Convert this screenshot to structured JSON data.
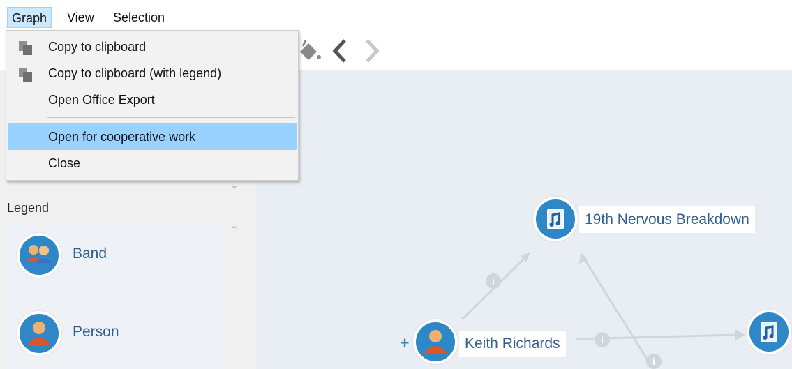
{
  "menubar": {
    "items": [
      {
        "label": "Graph"
      },
      {
        "label": "View"
      },
      {
        "label": "Selection"
      }
    ]
  },
  "dropdown": {
    "items": [
      {
        "label": "Copy to clipboard",
        "icon": "copy-icon"
      },
      {
        "label": "Copy to clipboard (with legend)",
        "icon": "copy-icon"
      },
      {
        "label": "Open Office Export",
        "icon": ""
      },
      {
        "label": "Open for cooperative work",
        "icon": "",
        "highlighted": true
      },
      {
        "label": "Close",
        "icon": ""
      }
    ]
  },
  "legend": {
    "title": "Legend",
    "items": [
      {
        "label": "Band",
        "icon": "band-icon"
      },
      {
        "label": "Person",
        "icon": "person-icon"
      }
    ]
  },
  "graph": {
    "nodes": [
      {
        "label": "19th Nervous Breakdown",
        "icon": "music-file-icon"
      },
      {
        "label": "Keith Richards",
        "icon": "person-icon"
      },
      {
        "label": "",
        "icon": "music-file-icon"
      }
    ]
  },
  "colors": {
    "accent": "#2e88c8",
    "menu_highlight": "#99d1ff",
    "canvas": "#e8eef4",
    "node_text": "#2f5f90"
  }
}
